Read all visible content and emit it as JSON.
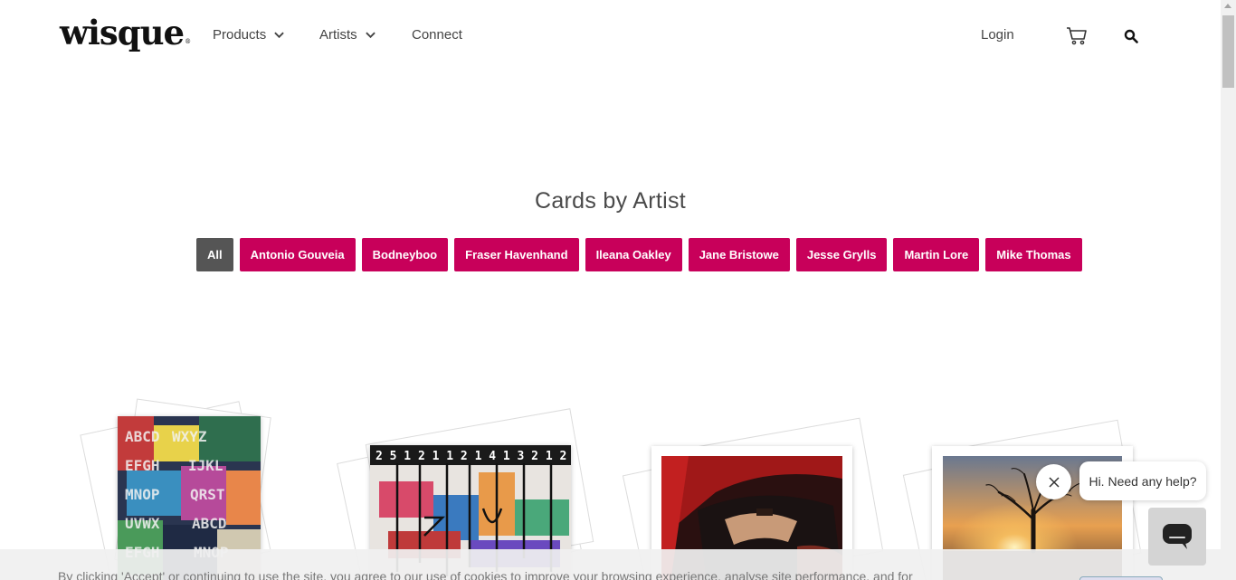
{
  "brand": {
    "logo_text": "wisque",
    "trademark": "®"
  },
  "nav": {
    "items": [
      {
        "label": "Products",
        "has_dropdown": true
      },
      {
        "label": "Artists",
        "has_dropdown": true
      },
      {
        "label": "Connect",
        "has_dropdown": false
      }
    ],
    "login_label": "Login",
    "cart_icon": "cart-icon",
    "search_icon": "search-icon"
  },
  "page": {
    "title": "Cards by Artist"
  },
  "filters": {
    "active": "All",
    "items": [
      "All",
      "Antonio Gouveia",
      "Bodneyboo",
      "Fraser Havenhand",
      "Ileana Oakley",
      "Jane Bristowe",
      "Jesse Grylls",
      "Martin Lore",
      "Mike Thomas"
    ]
  },
  "cards": [
    {
      "art": "colorful abstract alphabet painting"
    },
    {
      "art": "abstract graffiti number painting"
    },
    {
      "art": "red vintage car interior photograph"
    },
    {
      "art": "tree at sunset landscape photograph"
    }
  ],
  "chat": {
    "greeting": "Hi. Need any help?",
    "close_icon": "close-icon",
    "launcher_icon": "chat-icon"
  },
  "cookie_banner": {
    "text": "By clicking 'Accept' or continuing to use the site, you agree to our use of cookies to improve your browsing experience, analyse site performance, and for"
  },
  "colors": {
    "accent": "#c8005a",
    "active_filter": "#555555",
    "text": "#444444"
  }
}
